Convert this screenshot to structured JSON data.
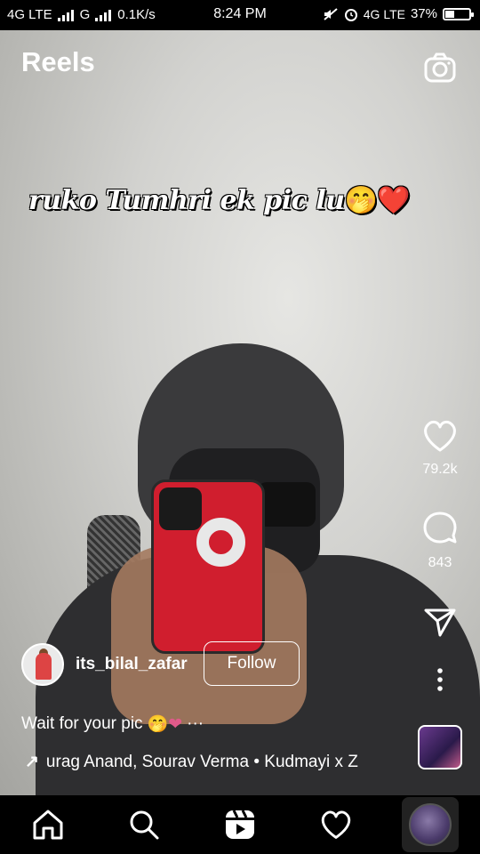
{
  "status_bar": {
    "network_left": "4G LTE",
    "network_second": "G",
    "speed": "0.1K/s",
    "time": "8:24 PM",
    "network_right": "4G LTE",
    "battery": "37%",
    "battery_level": 0.37
  },
  "header": {
    "title": "Reels",
    "camera_icon": "camera-icon"
  },
  "video": {
    "overlay_text": "ruko Tumhri ek pic lu",
    "overlay_emoji": "🤭",
    "overlay_heart": "❤️"
  },
  "actions": {
    "like_count": "79.2k",
    "comment_count": "843",
    "icons": [
      "heart-icon",
      "comment-icon",
      "share-icon",
      "more-icon"
    ]
  },
  "post": {
    "username": "its_bilal_zafar",
    "follow_label": "Follow",
    "caption": "Wait for your pic",
    "caption_emojis": "🤭❤",
    "caption_more": "···",
    "audio_arrow": "↗",
    "audio_text": "urag Anand, Sourav Verma • Kudmayi x Z"
  },
  "nav": {
    "items": [
      "home-icon",
      "search-icon",
      "reels-icon",
      "activity-icon",
      "profile-icon"
    ]
  },
  "colors": {
    "accent_red": "#e0202a",
    "background": "#000000"
  }
}
